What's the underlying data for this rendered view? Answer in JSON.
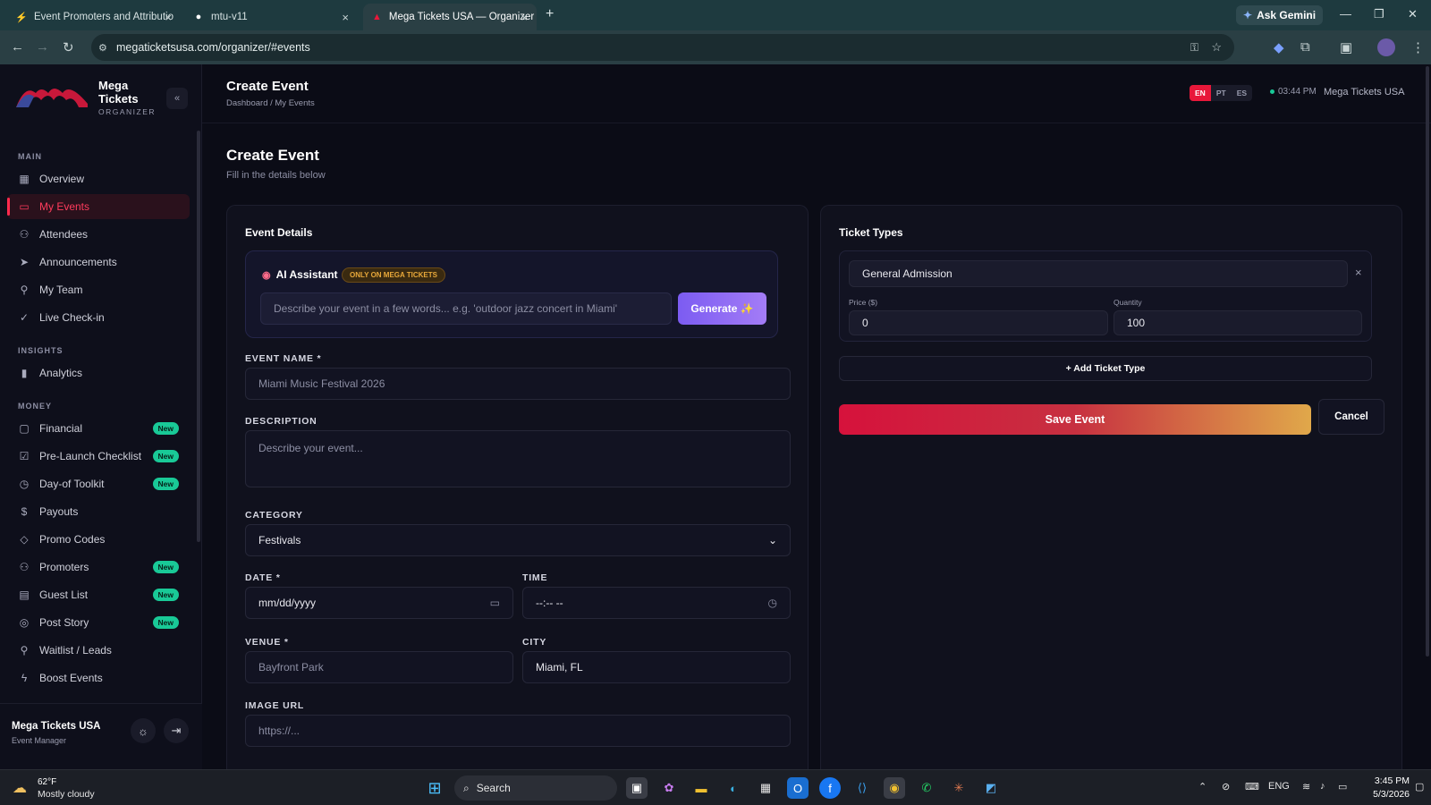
{
  "browser": {
    "tabs": [
      {
        "title": "Event Promoters and Attributio",
        "favicon": "bolt-icon"
      },
      {
        "title": "mtu-v11",
        "favicon": "github-icon"
      },
      {
        "title": "Mega Tickets USA — Organizer",
        "favicon": "mega-tickets-icon"
      }
    ],
    "url": "megaticketsusa.com/organizer/#events",
    "gemini_label": "Ask Gemini"
  },
  "sidebar": {
    "brand_line1": "Mega",
    "brand_line2": "Tickets",
    "brand_sub": "ORGANIZER",
    "sections": {
      "main": "MAIN",
      "insights": "INSIGHTS",
      "money": "MONEY"
    },
    "items": [
      {
        "label": "Overview",
        "icon": "grid-icon"
      },
      {
        "label": "My Events",
        "icon": "calendar-icon",
        "active": true
      },
      {
        "label": "Attendees",
        "icon": "users-icon"
      },
      {
        "label": "Announcements",
        "icon": "send-icon"
      },
      {
        "label": "My Team",
        "icon": "user-icon"
      },
      {
        "label": "Live Check-in",
        "icon": "check-circle-icon"
      },
      {
        "label": "Analytics",
        "icon": "bar-chart-icon"
      },
      {
        "label": "Financial",
        "icon": "message-icon",
        "badge": "New"
      },
      {
        "label": "Pre-Launch Checklist",
        "icon": "checkbox-icon",
        "badge": "New"
      },
      {
        "label": "Day-of Toolkit",
        "icon": "clock-icon",
        "badge": "New"
      },
      {
        "label": "Payouts",
        "icon": "dollar-icon"
      },
      {
        "label": "Promo Codes",
        "icon": "tag-icon"
      },
      {
        "label": "Promoters",
        "icon": "users-icon",
        "badge": "New"
      },
      {
        "label": "Guest List",
        "icon": "clipboard-icon",
        "badge": "New"
      },
      {
        "label": "Post Story",
        "icon": "circle-icon",
        "badge": "New"
      },
      {
        "label": "Waitlist / Leads",
        "icon": "user-plus-icon"
      },
      {
        "label": "Boost Events",
        "icon": "lightning-icon"
      }
    ],
    "footer_name": "Mega Tickets USA",
    "footer_role": "Event Manager"
  },
  "header": {
    "title": "Create Event",
    "breadcrumb": "Dashboard / My Events",
    "languages": [
      "EN",
      "PT",
      "ES"
    ],
    "time": "03:44 PM",
    "org": "Mega Tickets USA"
  },
  "page": {
    "title": "Create Event",
    "subtitle": "Fill in the details below"
  },
  "event_details": {
    "heading": "Event Details",
    "ai_title": "AI Assistant",
    "ai_tag": "ONLY ON MEGA TICKETS",
    "ai_placeholder": "Describe your event in a few words... e.g. 'outdoor jazz concert in Miami'",
    "generate_label": "Generate ✨",
    "name_label": "EVENT NAME *",
    "name_placeholder": "Miami Music Festival 2026",
    "desc_label": "DESCRIPTION",
    "desc_placeholder": "Describe your event...",
    "category_label": "CATEGORY",
    "category_value": "Festivals",
    "date_label": "DATE *",
    "date_value": "mm/dd/yyyy",
    "time_label": "TIME",
    "time_value": "--:-- --",
    "venue_label": "VENUE *",
    "venue_placeholder": "Bayfront Park",
    "city_label": "CITY",
    "city_value": "Miami, FL",
    "image_label": "IMAGE URL",
    "image_placeholder": "https://..."
  },
  "ticket_types": {
    "heading": "Ticket Types",
    "ticket_name": "General Admission",
    "price_label": "Price ($)",
    "price_value": "0",
    "quantity_label": "Quantity",
    "quantity_value": "100",
    "add_label": "+ Add Ticket Type",
    "save_label": "Save Event",
    "cancel_label": "Cancel"
  },
  "taskbar": {
    "weather_temp": "62°F",
    "weather_desc": "Mostly cloudy",
    "search_label": "Search",
    "lang": "ENG",
    "time": "3:45 PM",
    "date": "5/3/2026"
  },
  "colors": {
    "accent": "#e8183a",
    "badge": "#19c997",
    "generate": "#8b6cf4"
  }
}
